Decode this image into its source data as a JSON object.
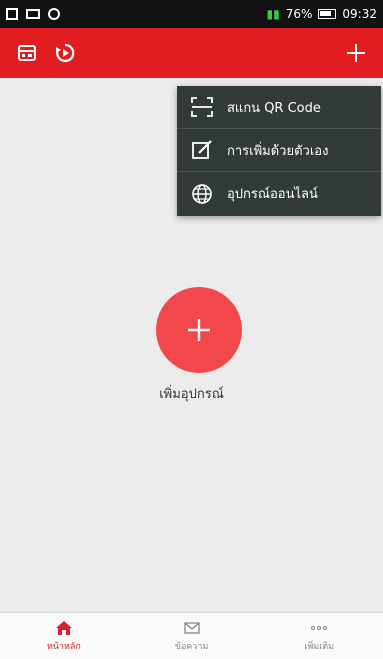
{
  "status_bar": {
    "battery": "76%",
    "time": "09:32"
  },
  "app_bar": {
    "left_icons": [
      "device-list-icon",
      "playback-icon"
    ],
    "right_icon": "plus-icon"
  },
  "dropdown": {
    "items": [
      {
        "icon": "qr-scan-icon",
        "label": "สแกน QR Code"
      },
      {
        "icon": "manual-add-icon",
        "label": "การเพิ่มด้วยตัวเอง"
      },
      {
        "icon": "globe-icon",
        "label": "อุปกรณ์ออนไลน์"
      }
    ]
  },
  "main": {
    "add_button_icon": "plus-icon",
    "add_label": "เพิ่มอุปกรณ์"
  },
  "bottom_nav": {
    "items": [
      {
        "icon": "home-icon",
        "label": "หน้าหลัก",
        "active": true
      },
      {
        "icon": "message-icon",
        "label": "ข้อความ",
        "active": false
      },
      {
        "icon": "more-icon",
        "label": "เพิ่มเติม",
        "active": false
      }
    ]
  },
  "colors": {
    "brand_red": "#e21d22",
    "fab_red": "#f2484c",
    "menu_bg": "#333a3a",
    "page_bg": "#ebebeb"
  }
}
